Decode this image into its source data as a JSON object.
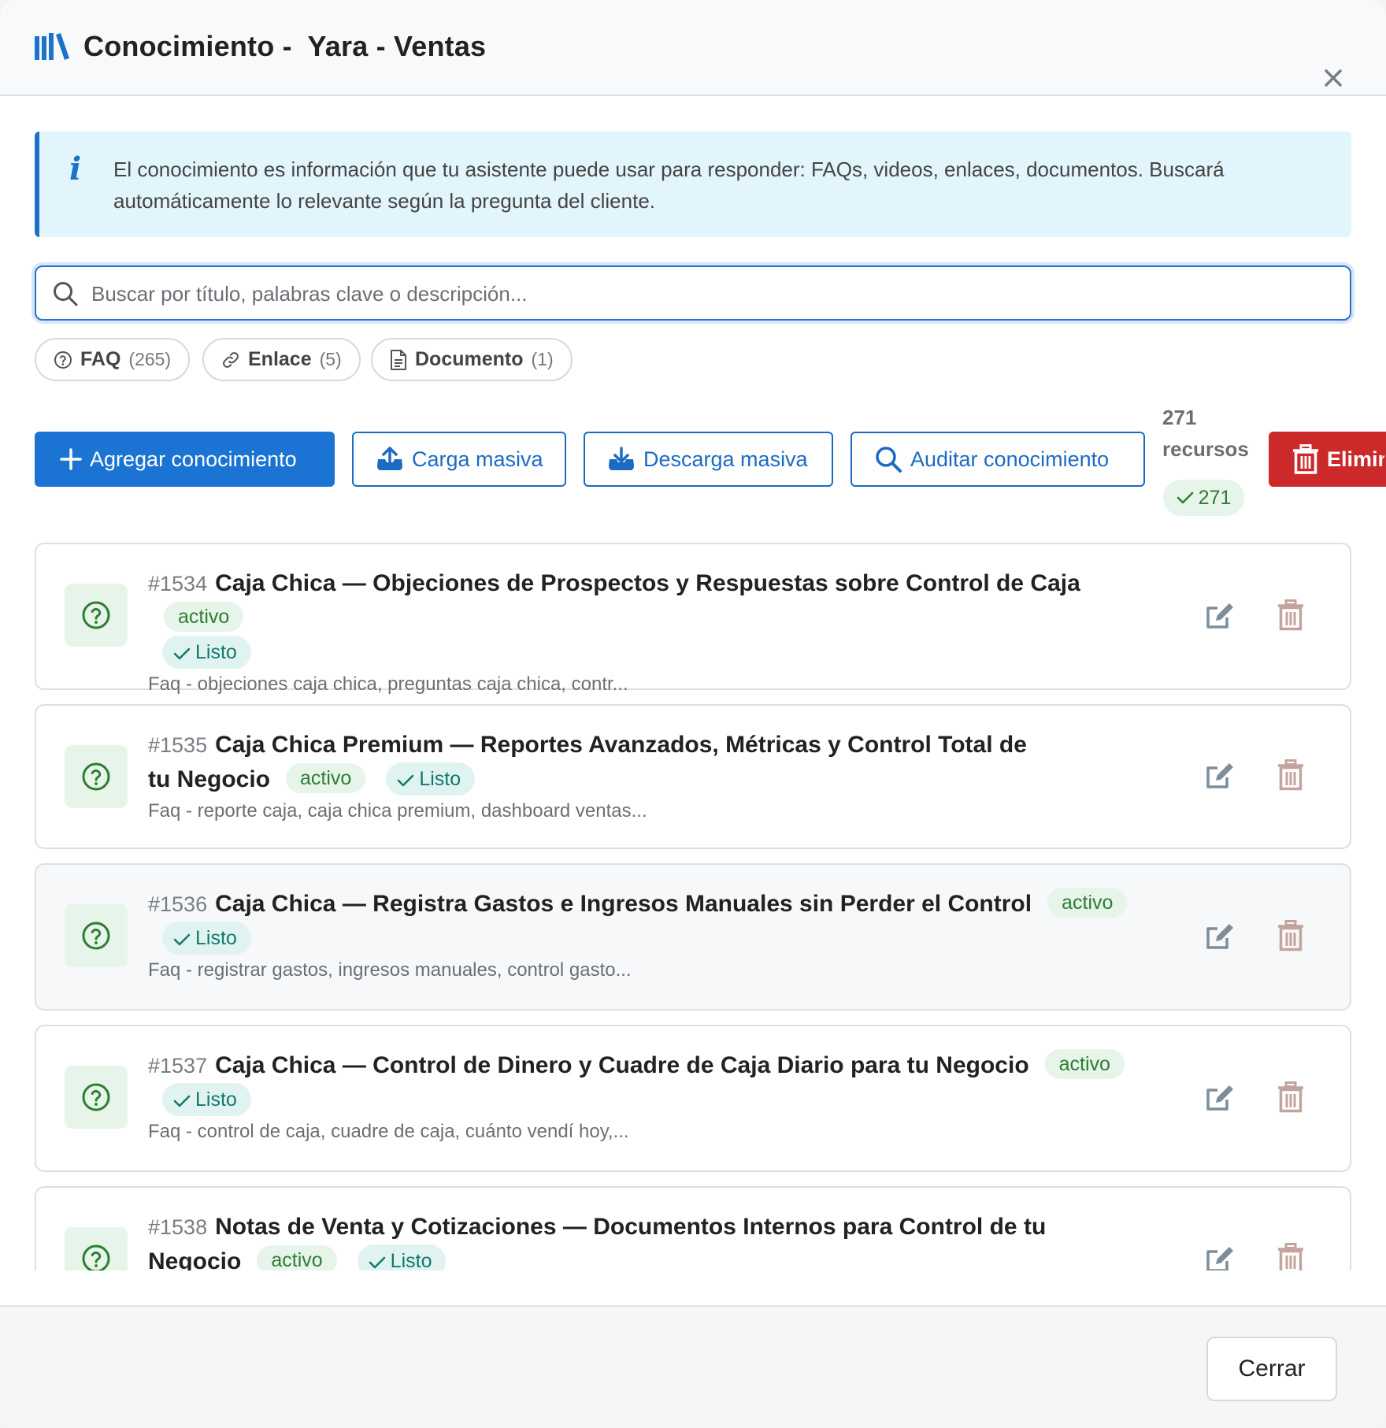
{
  "header": {
    "title": "Conocimiento -  Yara - Ventas",
    "icon": "library-books-icon",
    "close_icon": "close-icon"
  },
  "info": {
    "icon": "info-icon",
    "icon_glyph": "i",
    "text": "El conocimiento es información que tu asistente puede usar para responder: FAQs, videos, enlaces, documentos. Buscará automáticamente lo relevante según la pregunta del cliente."
  },
  "search": {
    "placeholder": "Buscar por título, palabras clave o descripción...",
    "value": ""
  },
  "filters": [
    {
      "label": "FAQ",
      "count": "(265)",
      "icon": "question-circle-icon"
    },
    {
      "label": "Enlace",
      "count": "(5)",
      "icon": "link-icon"
    },
    {
      "label": "Documento",
      "count": "(1)",
      "icon": "document-icon"
    }
  ],
  "actions": {
    "add": "Agregar conocimiento",
    "upload": "Carga masiva",
    "download": "Descarga masiva",
    "audit": "Auditar conocimiento",
    "delete": "Elimin"
  },
  "resources": {
    "count_label": "271 recursos",
    "ready_count": "271"
  },
  "items": [
    {
      "id": "#1534",
      "title": "Caja Chica — Objeciones de Prospectos y Respuestas sobre Control de Caja",
      "status": "activo",
      "state": "Listo",
      "desc": "Faq - objeciones caja chica, preguntas caja chica, contr..."
    },
    {
      "id": "#1535",
      "title": "Caja Chica Premium — Reportes Avanzados, Métricas y Control Total de tu Negocio",
      "status": "activo",
      "state": "Listo",
      "desc": "Faq - reporte caja, caja chica premium, dashboard ventas..."
    },
    {
      "id": "#1536",
      "title": "Caja Chica — Registra Gastos e Ingresos Manuales sin Perder el Control",
      "status": "activo",
      "state": "Listo",
      "desc": "Faq - registrar gastos, ingresos manuales, control gasto..."
    },
    {
      "id": "#1537",
      "title": "Caja Chica — Control de Dinero y Cuadre de Caja Diario para tu Negocio",
      "status": "activo",
      "state": "Listo",
      "desc": "Faq - control de caja, cuadre de caja, cuánto vendí hoy,..."
    },
    {
      "id": "#1538",
      "title": "Notas de Venta y Cotizaciones — Documentos Internos para Control de tu Negocio",
      "status": "activo",
      "state": "Listo",
      "desc": ""
    }
  ],
  "footer": {
    "close": "Cerrar"
  },
  "colors": {
    "primary": "#1b73d3",
    "danger": "#cc2a2a",
    "success": "#2e7d32",
    "info_bg": "#e2f4fc"
  }
}
